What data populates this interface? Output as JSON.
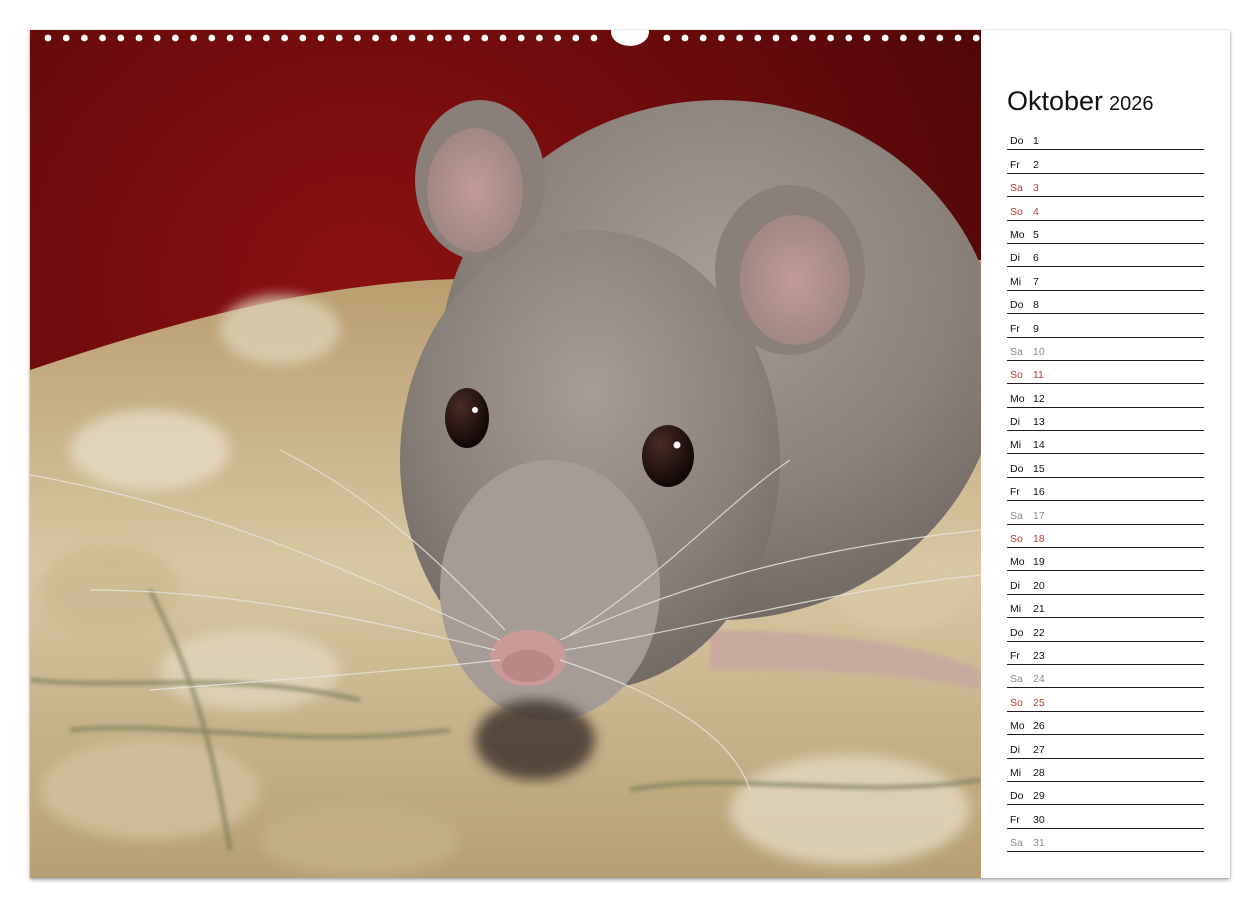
{
  "calendar": {
    "month": "Oktober",
    "year": "2026",
    "weekend_colors": {
      "saturday": "#8a8a8a",
      "sunday": "#c0392b",
      "regular": "#111111"
    },
    "days": [
      {
        "weekday": "Do",
        "day": "1",
        "type": "weekday"
      },
      {
        "weekday": "Fr",
        "day": "2",
        "type": "weekday"
      },
      {
        "weekday": "Sa",
        "day": "3",
        "type": "sun"
      },
      {
        "weekday": "So",
        "day": "4",
        "type": "sun"
      },
      {
        "weekday": "Mo",
        "day": "5",
        "type": "weekday"
      },
      {
        "weekday": "Di",
        "day": "6",
        "type": "weekday"
      },
      {
        "weekday": "Mi",
        "day": "7",
        "type": "weekday"
      },
      {
        "weekday": "Do",
        "day": "8",
        "type": "weekday"
      },
      {
        "weekday": "Fr",
        "day": "9",
        "type": "weekday"
      },
      {
        "weekday": "Sa",
        "day": "10",
        "type": "sat"
      },
      {
        "weekday": "So",
        "day": "11",
        "type": "sun"
      },
      {
        "weekday": "Mo",
        "day": "12",
        "type": "weekday"
      },
      {
        "weekday": "Di",
        "day": "13",
        "type": "weekday"
      },
      {
        "weekday": "Mi",
        "day": "14",
        "type": "weekday"
      },
      {
        "weekday": "Do",
        "day": "15",
        "type": "weekday"
      },
      {
        "weekday": "Fr",
        "day": "16",
        "type": "weekday"
      },
      {
        "weekday": "Sa",
        "day": "17",
        "type": "sat"
      },
      {
        "weekday": "So",
        "day": "18",
        "type": "sun"
      },
      {
        "weekday": "Mo",
        "day": "19",
        "type": "weekday"
      },
      {
        "weekday": "Di",
        "day": "20",
        "type": "weekday"
      },
      {
        "weekday": "Mi",
        "day": "21",
        "type": "weekday"
      },
      {
        "weekday": "Do",
        "day": "22",
        "type": "weekday"
      },
      {
        "weekday": "Fr",
        "day": "23",
        "type": "weekday"
      },
      {
        "weekday": "Sa",
        "day": "24",
        "type": "sat"
      },
      {
        "weekday": "So",
        "day": "25",
        "type": "sun"
      },
      {
        "weekday": "Mo",
        "day": "26",
        "type": "weekday"
      },
      {
        "weekday": "Di",
        "day": "27",
        "type": "weekday"
      },
      {
        "weekday": "Mi",
        "day": "28",
        "type": "weekday"
      },
      {
        "weekday": "Do",
        "day": "29",
        "type": "weekday"
      },
      {
        "weekday": "Fr",
        "day": "30",
        "type": "weekday"
      },
      {
        "weekday": "Sa",
        "day": "31",
        "type": "sat"
      }
    ]
  },
  "photo": {
    "subject": "rat-photo",
    "colors": {
      "background_red": "#7a0d0d",
      "fur": "#8e847e",
      "bedding": "#c9b48a"
    }
  }
}
